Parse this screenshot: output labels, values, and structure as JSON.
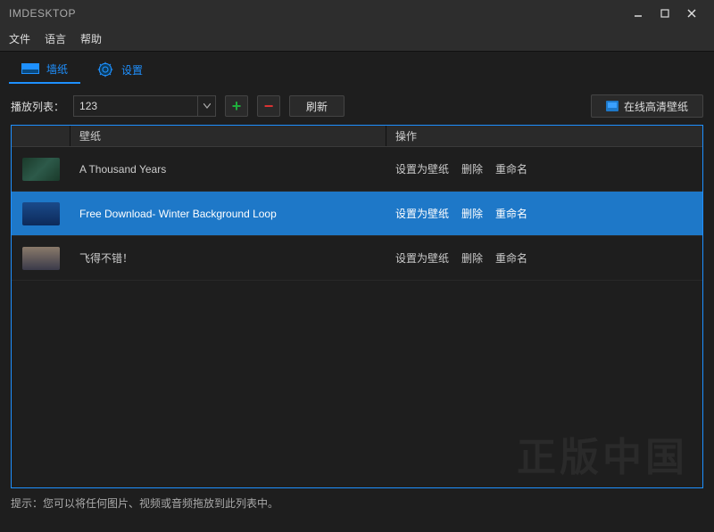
{
  "window": {
    "title": "IMDESKTOP"
  },
  "menus": {
    "file": "文件",
    "language": "语言",
    "help": "帮助"
  },
  "tabs": {
    "wallpaper": "墙纸",
    "settings": "设置"
  },
  "toolbar": {
    "playlist_label": "播放列表：",
    "playlist_selected": "123",
    "refresh": "刷新",
    "online_hd": "在线高清壁纸"
  },
  "table": {
    "header_name": "壁纸",
    "header_ops": "操作",
    "ops": {
      "set": "设置为壁纸",
      "delete": "删除",
      "rename": "重命名"
    },
    "rows": [
      {
        "name": "A Thousand Years",
        "selected": false,
        "thumb_color": "linear-gradient(135deg,#1a3a2a,#2d5a4a,#1a3a2a)"
      },
      {
        "name": "Free Download- Winter Background Loop",
        "selected": true,
        "thumb_color": "linear-gradient(to bottom,#1a4a8a,#0d2a5a)"
      },
      {
        "name": "飞得不错！",
        "selected": false,
        "thumb_color": "linear-gradient(to bottom,#8a7a6a,#3a3a4a)"
      }
    ]
  },
  "watermark": "正版中国",
  "statusbar": "提示：您可以将任何图片、视频或音频拖放到此列表中。"
}
